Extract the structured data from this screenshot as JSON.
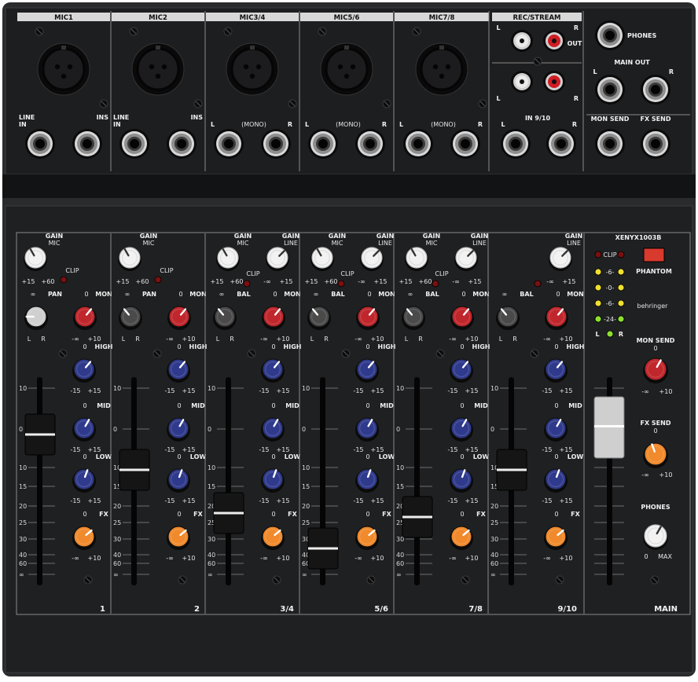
{
  "top_panel": {
    "mic_headers": [
      "MIC1",
      "MIC2",
      "MIC3/4",
      "MIC5/6",
      "MIC7/8"
    ],
    "rec_stream_header": "REC/STREAM",
    "line_in_label": "LINE\nIN",
    "ins_label": "INS",
    "mono_label": "(MONO)",
    "l": "L",
    "r": "R",
    "out_label": "OUT",
    "in_910_label": "IN 9/10",
    "phones_label": "PHONES",
    "main_out_label": "MAIN OUT",
    "mon_send_label": "MON SEND",
    "fx_send_label": "FX SEND"
  },
  "channel_strip": {
    "gain": "GAIN",
    "mic": "MIC",
    "line": "LINE",
    "clip": "CLIP",
    "pan": "PAN",
    "bal": "BAL",
    "mon": "MON",
    "high": "HIGH",
    "mid": "MID",
    "low": "LOW",
    "fx": "FX",
    "zero": "0",
    "mic_range": [
      "+15",
      "+60"
    ],
    "line_range": [
      "-∞",
      "+15"
    ],
    "level_range": [
      "-∞",
      "+10"
    ],
    "eq_range": [
      "-15",
      "+15"
    ]
  },
  "channel_numbers": [
    "1",
    "2",
    "3/4",
    "5/6",
    "7/8",
    "9/10"
  ],
  "fader_scale": [
    "10",
    "0",
    "10",
    "15",
    "20",
    "25",
    "30",
    "40",
    "60",
    "∞"
  ],
  "fader_levels": [
    0.78,
    0.6,
    0.38,
    0.2,
    0.36,
    0.6
  ],
  "main_section": {
    "brand_model": "XENYX1003B",
    "brand": "behringer",
    "clip": "CLIP",
    "meter_labels": [
      "6",
      "0",
      "6",
      "24"
    ],
    "meter_l": "L",
    "meter_r": "R",
    "phantom": "PHANTOM",
    "mon_send": "MON SEND",
    "fx_send": "FX SEND",
    "phones": "PHONES",
    "phones_range": [
      "0",
      "MAX"
    ],
    "main_label": "MAIN",
    "main_fader_level": 0.82
  },
  "colors": {
    "panel": "#202123",
    "knob_white": "#f2f2f2",
    "knob_red": "#c0272d",
    "knob_blue": "#2f3a8c",
    "knob_orange": "#f08a2c",
    "led_red": "#7a1010",
    "led_yellow": "#f0e030",
    "led_green": "#8ee030",
    "phantom_button": "#d93a2e"
  }
}
